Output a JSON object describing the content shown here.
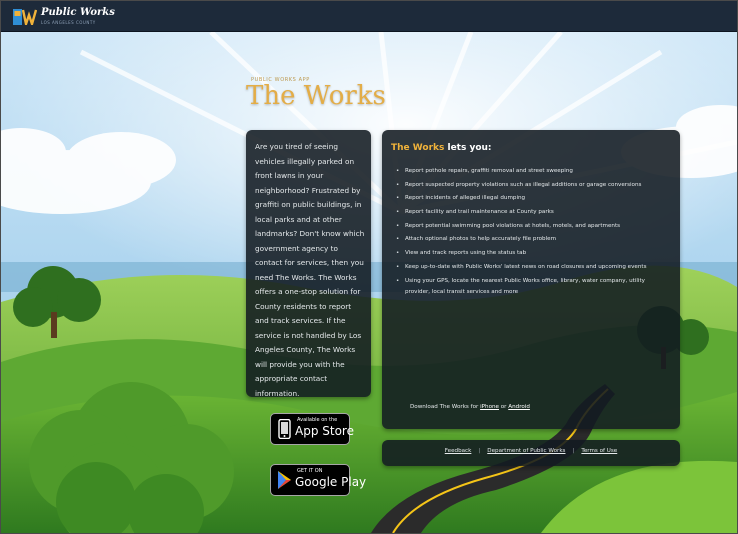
{
  "header": {
    "brand_name": "Public Works",
    "brand_subtitle": "LOS ANGELES COUNTY"
  },
  "hero": {
    "kicker": "PUBLIC WORKS APP",
    "title": "The Works"
  },
  "intro": {
    "text": "Are you tired of seeing vehicles illegally parked on front lawns in your neighborhood? Frustrated by graffiti on public buildings, in local parks and at other landmarks? Don't know which government agency to contact for services, then you need The Works. The Works offers a one-stop solution for County residents to report and track services. If the service is not handled by Los Angeles County, The Works will provide you with the appropriate contact information."
  },
  "features": {
    "heading_accent": "The Works",
    "heading_rest": " lets you:",
    "items": [
      "Report pothole repairs, graffiti removal and street sweeping",
      "Report suspected property violations such as illegal additions or garage conversions",
      "Report incidents of alleged illegal dumping",
      "Report facility and trail maintenance at County parks",
      "Report potential swimming pool violations at hotels, motels, and apartments",
      "Attach optional photos to help accurately file problem",
      "View and track reports using the status tab",
      "Keep up-to-date with Public Works' latest news on road closures and upcoming events",
      "Using your GPS, locate the nearest Public Works office, library, water company, utility provider, local transit services and more"
    ],
    "download_prefix": "Download The Works for ",
    "download_iphone": "iPhone",
    "download_mid": " or ",
    "download_android": "Android"
  },
  "footer": {
    "links": [
      "Feedback",
      "Department of Public Works",
      "Terms of Use"
    ],
    "separator": "|"
  },
  "badges": {
    "apple_small": "Available on the",
    "apple_big": "App Store",
    "google_small": "GET IT ON",
    "google_big": "Google Play"
  },
  "colors": {
    "topbar": "#1d2a3a",
    "panel": "#121a21",
    "accent": "#f0b23a",
    "title_gold": "#e3ad47",
    "road": "#2b2b2b",
    "road_line": "#f5c518"
  }
}
